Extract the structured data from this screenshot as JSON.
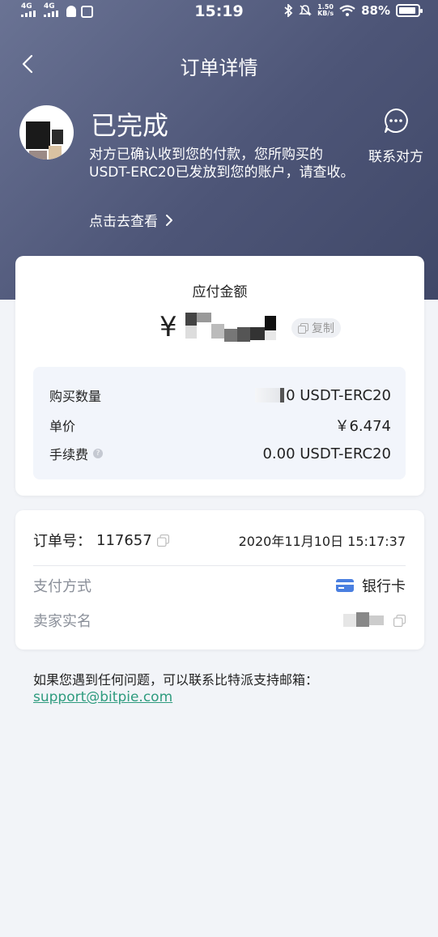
{
  "status_bar": {
    "signal1": "4G",
    "signal2": "4G",
    "time": "15:19",
    "net_speed_value": "1.50",
    "net_speed_unit": "KB/s",
    "battery": "88%"
  },
  "nav": {
    "title": "订单详情"
  },
  "status": {
    "title": "已完成",
    "description": "对方已确认收到您的付款，您所购买的USDT-ERC20已发放到您的账户，请查收。",
    "check_link": "点击去查看",
    "contact_label": "联系对方"
  },
  "payment": {
    "label": "应付金额",
    "currency_symbol": "¥",
    "copy_label": "复制",
    "rows": [
      {
        "label": "购买数量",
        "value": "0 USDT-ERC20"
      },
      {
        "label": "单价",
        "value": "￥6.474"
      },
      {
        "label": "手续费",
        "value": "0.00 USDT-ERC20"
      }
    ]
  },
  "order": {
    "number_label": "订单号：",
    "number": "117657",
    "date": "2020年11月10日 15:17:37",
    "pay_method_label": "支付方式",
    "pay_method_value": "银行卡",
    "seller_label": "卖家实名"
  },
  "help": {
    "text": "如果您遇到任何问题，可以联系比特派支持邮箱：",
    "email": "support@bitpie.com"
  },
  "colors": {
    "header_gradient_start": "#6a7394",
    "header_gradient_end": "#404868",
    "link": "#2e9b7e",
    "card_icon": "#4a7fe0"
  }
}
